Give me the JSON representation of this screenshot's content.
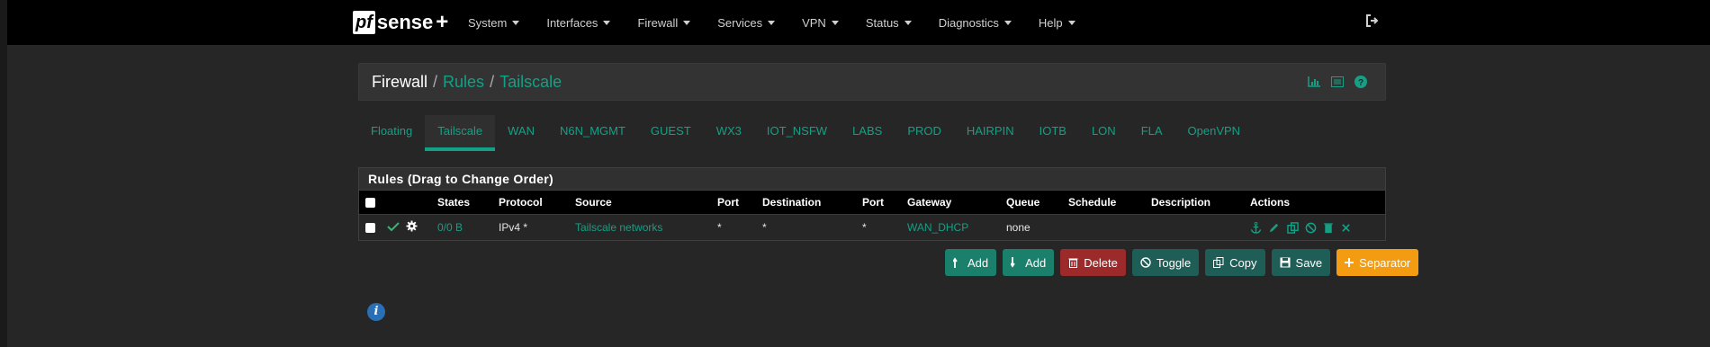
{
  "brand": {
    "pf": "pf",
    "sense": "sense",
    "plus": "+"
  },
  "nav": [
    {
      "label": "System"
    },
    {
      "label": "Interfaces"
    },
    {
      "label": "Firewall"
    },
    {
      "label": "Services"
    },
    {
      "label": "VPN"
    },
    {
      "label": "Status"
    },
    {
      "label": "Diagnostics"
    },
    {
      "label": "Help"
    }
  ],
  "breadcrumb": {
    "firewall": "Firewall",
    "sep1": "/",
    "rules": "Rules",
    "sep2": "/",
    "current": "Tailscale"
  },
  "tabs": [
    "Floating",
    "Tailscale",
    "WAN",
    "N6N_MGMT",
    "GUEST",
    "WX3",
    "IOT_NSFW",
    "LABS",
    "PROD",
    "HAIRPIN",
    "IOTB",
    "LON",
    "FLA",
    "OpenVPN"
  ],
  "active_tab": "Tailscale",
  "rules": {
    "heading": "Rules (Drag to Change Order)",
    "columns": {
      "states": "States",
      "protocol": "Protocol",
      "source": "Source",
      "port": "Port",
      "destination": "Destination",
      "port2": "Port",
      "gateway": "Gateway",
      "queue": "Queue",
      "schedule": "Schedule",
      "description": "Description",
      "actions": "Actions"
    },
    "row": {
      "states": "0/0 B",
      "protocol": "IPv4 *",
      "source": "Tailscale networks",
      "port": "*",
      "destination": "*",
      "port2": "*",
      "gateway": "WAN_DHCP",
      "queue": "none",
      "schedule": "",
      "description": ""
    }
  },
  "buttons": {
    "add_top": "Add",
    "add_bottom": "Add",
    "delete": "Delete",
    "toggle": "Toggle",
    "copy": "Copy",
    "save": "Save",
    "separator": "Separator"
  },
  "info": "i",
  "colors": {
    "accent": "#14a085",
    "navbar": "#000000",
    "background": "#262626",
    "separator": "#f39c12",
    "delete": "#9c2a2a"
  }
}
